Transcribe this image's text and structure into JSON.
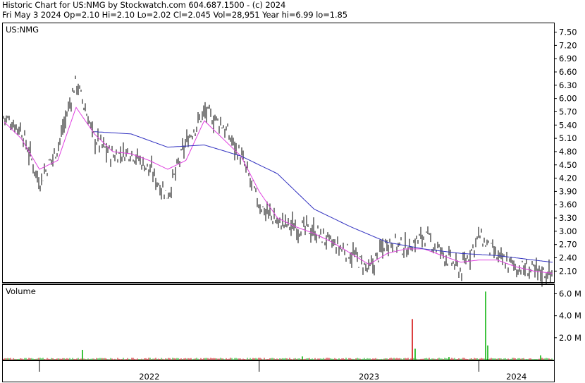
{
  "header": {
    "title_line": "Historic Chart for US:NMG by Stockwatch.com 604.687.1500 - (c) 2024",
    "quote_line": "Fri May  3 2024   Op=2.10  Hi=2.10  Lo=2.02  Cl=2.045  Vol=28,951  Year hi=6.99  lo=1.85"
  },
  "colors": {
    "price_bars": "#000000",
    "ma_short": "#e040e0",
    "ma_long": "#3030c0",
    "volume_up": "#00b000",
    "volume_down": "#d00000",
    "frame": "#000000"
  },
  "chart_data": [
    {
      "type": "line",
      "chart_style": "ohlc-bars with moving averages",
      "symbol_label": "US:NMG",
      "y_ticks": [
        "7.50",
        "7.20",
        "6.90",
        "6.60",
        "6.30",
        "6.00",
        "5.70",
        "5.40",
        "5.10",
        "4.80",
        "4.50",
        "4.20",
        "3.90",
        "3.60",
        "3.30",
        "3.00",
        "2.70",
        "2.40",
        "2.10"
      ],
      "ylim": [
        1.85,
        7.7
      ],
      "x_labels": [
        "2022",
        "2023",
        "2024"
      ],
      "series": [
        {
          "role": "price_close",
          "x": [
            "2021-11",
            "2021-12",
            "2022-01",
            "2022-02",
            "2022-03",
            "2022-04",
            "2022-05",
            "2022-06",
            "2022-07",
            "2022-08",
            "2022-09",
            "2022-10",
            "2022-11",
            "2022-12",
            "2023-01",
            "2023-02",
            "2023-03",
            "2023-04",
            "2023-05",
            "2023-06",
            "2023-07",
            "2023-08",
            "2023-09",
            "2023-10",
            "2023-11",
            "2023-12",
            "2024-01",
            "2024-02",
            "2024-03",
            "2024-04",
            "2024-05"
          ],
          "values": [
            5.6,
            5.3,
            4.1,
            4.9,
            6.4,
            5.1,
            4.7,
            4.8,
            4.4,
            3.8,
            5.0,
            5.7,
            5.4,
            4.7,
            3.6,
            3.2,
            3.1,
            3.0,
            2.7,
            2.5,
            2.1,
            2.8,
            2.6,
            2.9,
            2.5,
            2.1,
            2.9,
            2.4,
            2.2,
            2.1,
            2.05
          ]
        },
        {
          "role": "moving_average_short",
          "x": [
            "2021-11",
            "2021-12",
            "2022-01",
            "2022-02",
            "2022-03",
            "2022-04",
            "2022-05",
            "2022-06",
            "2022-07",
            "2022-08",
            "2022-09",
            "2022-10",
            "2022-11",
            "2022-12",
            "2023-01",
            "2023-02",
            "2023-03",
            "2023-04",
            "2023-05",
            "2023-06",
            "2023-07",
            "2023-08",
            "2023-09",
            "2023-10",
            "2023-11",
            "2023-12",
            "2024-01",
            "2024-02",
            "2024-03",
            "2024-04",
            "2024-05"
          ],
          "values": [
            5.5,
            5.1,
            4.4,
            4.6,
            5.8,
            5.2,
            4.8,
            4.75,
            4.6,
            4.4,
            4.6,
            5.5,
            5.1,
            4.7,
            3.9,
            3.3,
            3.1,
            2.95,
            2.75,
            2.5,
            2.25,
            2.5,
            2.6,
            2.6,
            2.45,
            2.3,
            2.35,
            2.35,
            2.2,
            2.1,
            2.05
          ]
        },
        {
          "role": "moving_average_long",
          "x": [
            "2022-04",
            "2022-06",
            "2022-08",
            "2022-10",
            "2022-12",
            "2023-02",
            "2023-04",
            "2023-06",
            "2023-08",
            "2023-10",
            "2023-12",
            "2024-02",
            "2024-04",
            "2024-05"
          ],
          "values": [
            5.25,
            5.2,
            4.9,
            4.95,
            4.7,
            4.3,
            3.5,
            3.1,
            2.75,
            2.6,
            2.5,
            2.45,
            2.35,
            2.3
          ]
        }
      ]
    },
    {
      "type": "bar",
      "panel_label": "Volume",
      "y_ticks": [
        "6.0 M",
        "4.0 M",
        "2.0 M"
      ],
      "ylim": [
        0,
        6.8
      ],
      "unit": "M",
      "spikes": [
        {
          "x": "2022-03",
          "value": 0.9
        },
        {
          "x": "2023-03",
          "value": 0.3
        },
        {
          "x": "2023-09",
          "value": 3.7
        },
        {
          "x": "2023-09",
          "value": 1.0
        },
        {
          "x": "2023-11",
          "value": 0.25
        },
        {
          "x": "2024-01",
          "value": 6.2
        },
        {
          "x": "2024-01",
          "value": 1.3
        },
        {
          "x": "2024-04",
          "value": 0.4
        }
      ],
      "baseline_level": 0.12
    }
  ]
}
